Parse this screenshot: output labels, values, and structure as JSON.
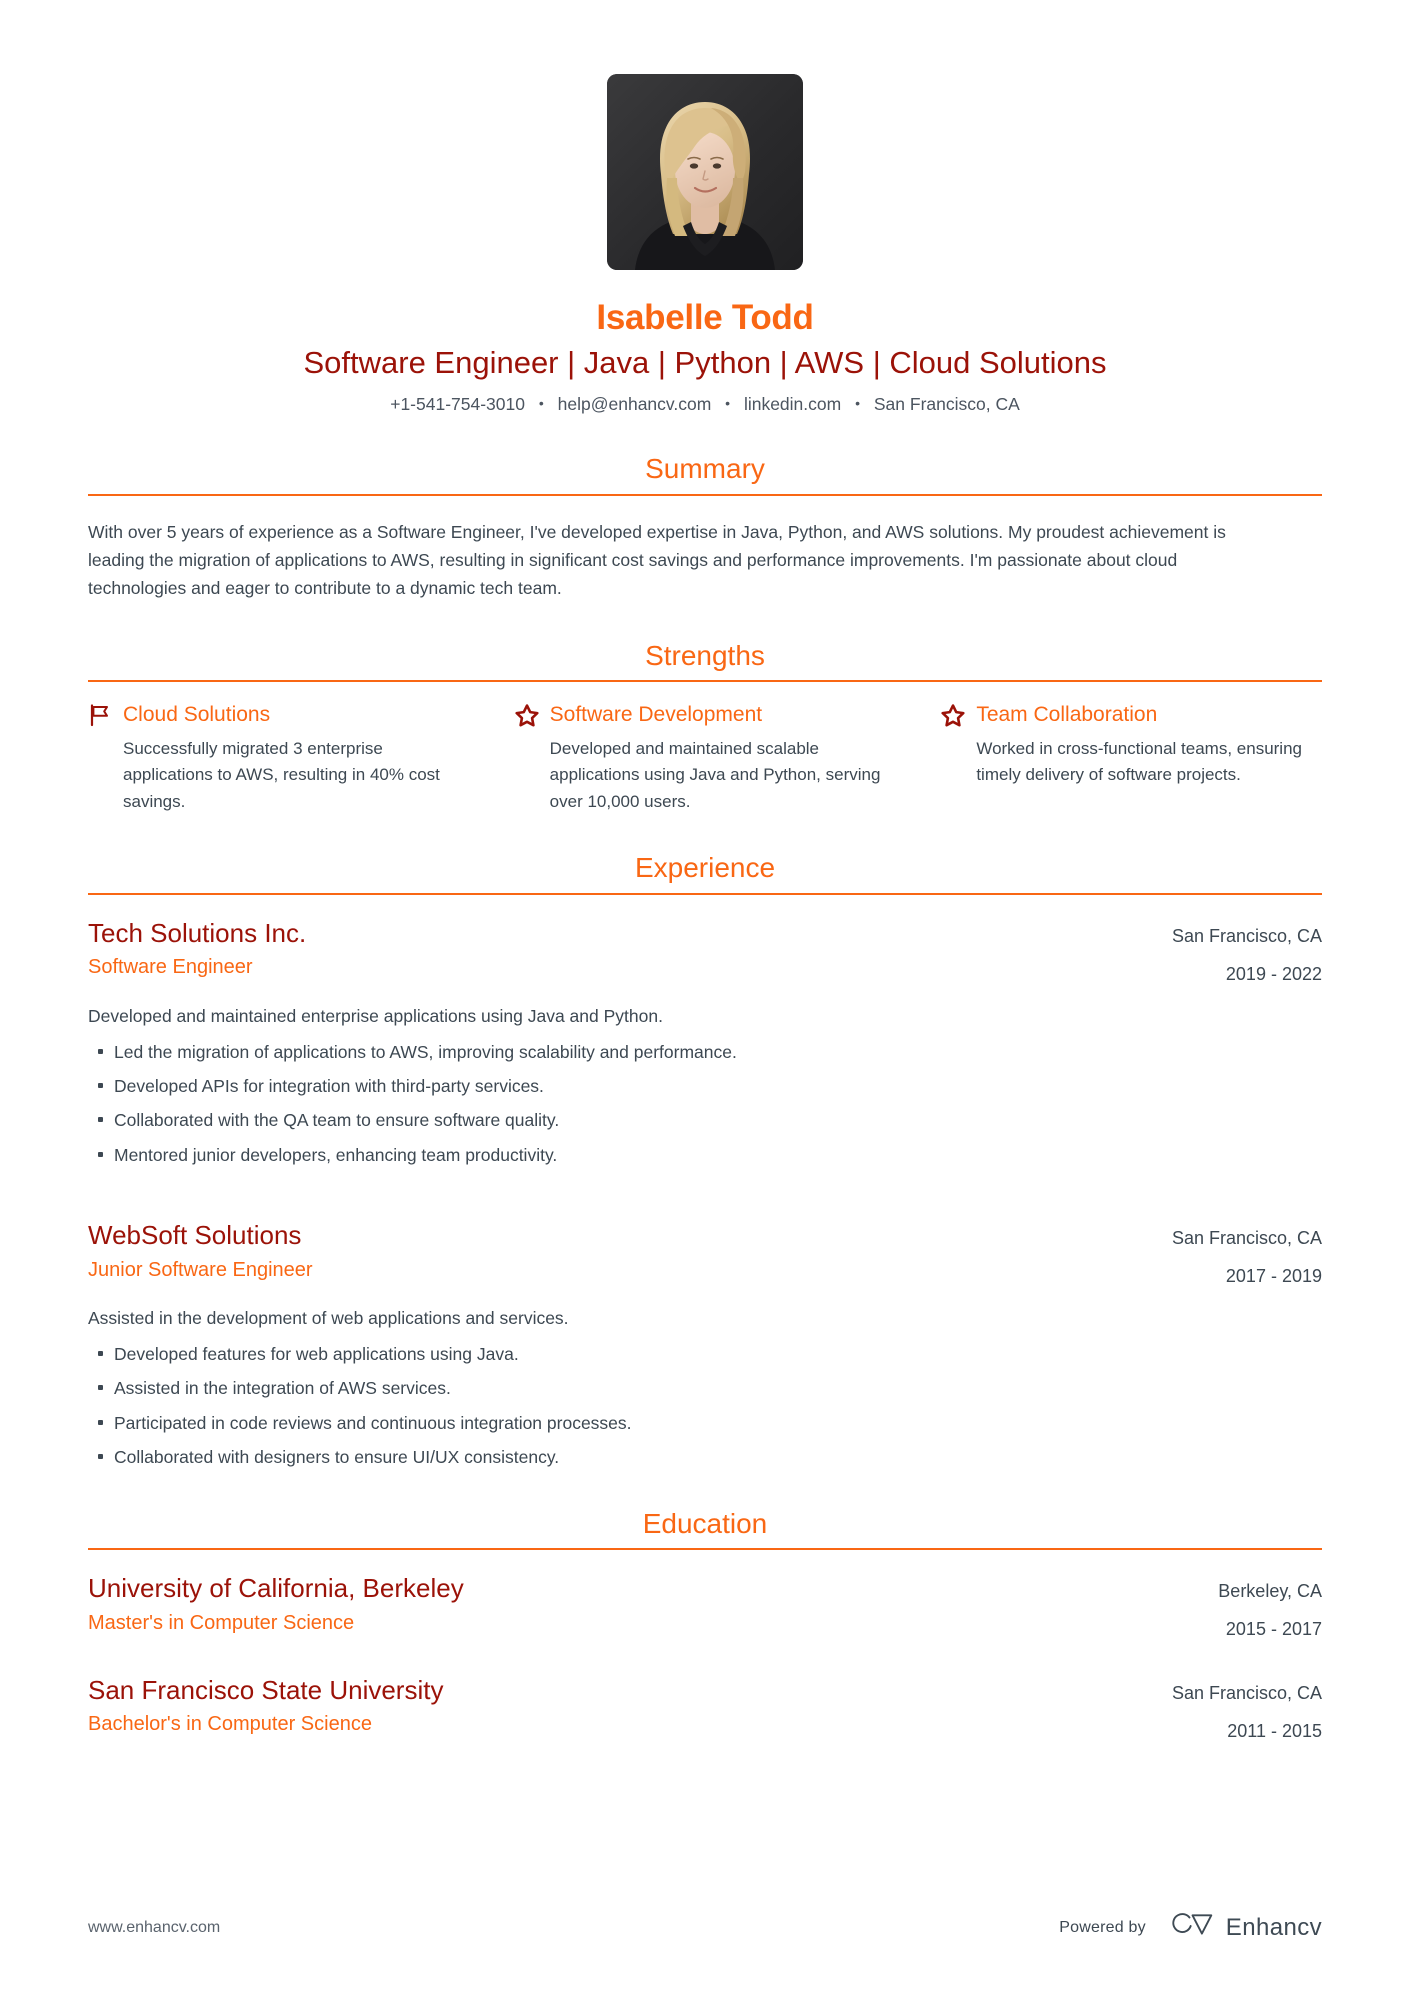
{
  "document": {
    "type": "resume"
  },
  "colors": {
    "accent_orange": "#f96714",
    "accent_dark_red": "#9b1208",
    "body_text": "#3d4852",
    "page_background": "#ffffff"
  },
  "header": {
    "avatar_alt": "profile-photo",
    "name": "Isabelle Todd",
    "headline": "Software Engineer | Java | Python | AWS | Cloud Solutions",
    "contact": {
      "phone": "+1-541-754-3010",
      "email": "help@enhancv.com",
      "website": "linkedin.com",
      "location": "San Francisco, CA",
      "separator": "•"
    }
  },
  "sections": {
    "summary": {
      "title": "Summary",
      "text": "With over 5 years of experience as a Software Engineer, I've developed expertise in Java, Python, and AWS solutions. My proudest achievement is leading the migration of applications to AWS, resulting in significant cost savings and performance improvements. I'm passionate about cloud technologies and eager to contribute to a dynamic tech team."
    },
    "strengths": {
      "title": "Strengths",
      "items": [
        {
          "icon": "flag-icon",
          "title": "Cloud Solutions",
          "description": "Successfully migrated 3 enterprise applications to AWS, resulting in 40% cost savings."
        },
        {
          "icon": "star-icon",
          "title": "Software Development",
          "description": "Developed and maintained scalable applications using Java and Python, serving over 10,000 users."
        },
        {
          "icon": "star-icon",
          "title": "Team Collaboration",
          "description": "Worked in cross-functional teams, ensuring timely delivery of software projects."
        }
      ]
    },
    "experience": {
      "title": "Experience",
      "items": [
        {
          "organization": "Tech Solutions Inc.",
          "role": "Software Engineer",
          "location": "San Francisco, CA",
          "dates": "2019 - 2022",
          "summary": "Developed and maintained enterprise applications using Java and Python.",
          "bullets": [
            "Led the migration of applications to AWS, improving scalability and performance.",
            "Developed APIs for integration with third-party services.",
            "Collaborated with the QA team to ensure software quality.",
            "Mentored junior developers, enhancing team productivity."
          ]
        },
        {
          "organization": "WebSoft Solutions",
          "role": "Junior Software Engineer",
          "location": "San Francisco, CA",
          "dates": "2017 - 2019",
          "summary": "Assisted in the development of web applications and services.",
          "bullets": [
            "Developed features for web applications using Java.",
            "Assisted in the integration of AWS services.",
            "Participated in code reviews and continuous integration processes.",
            "Collaborated with designers to ensure UI/UX consistency."
          ]
        }
      ]
    },
    "education": {
      "title": "Education",
      "items": [
        {
          "organization": "University of California, Berkeley",
          "degree": "Master's in Computer Science",
          "location": "Berkeley, CA",
          "dates": "2015 - 2017"
        },
        {
          "organization": "San Francisco State University",
          "degree": "Bachelor's in Computer Science",
          "location": "San Francisco, CA",
          "dates": "2011 - 2015"
        }
      ]
    }
  },
  "footer": {
    "url": "www.enhancv.com",
    "powered_by_label": "Powered by",
    "brand_name": "Enhancv",
    "brand_logo_icon": "enhancv-logo-icon"
  }
}
